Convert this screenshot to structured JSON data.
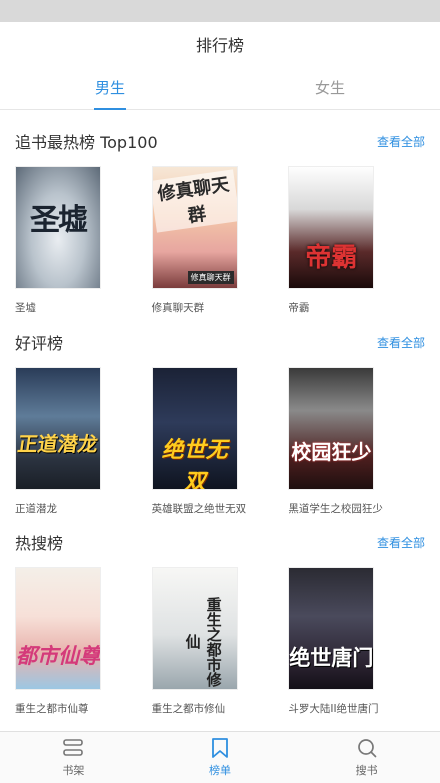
{
  "header": {
    "title": "排行榜"
  },
  "tabs": [
    {
      "label": "男生",
      "active": true
    },
    {
      "label": "女生",
      "active": false
    }
  ],
  "sections": [
    {
      "title": "追书最热榜 Top100",
      "see_all": "查看全部",
      "books": [
        {
          "name": "圣墟",
          "cover_text": "圣墟"
        },
        {
          "name": "修真聊天群",
          "cover_text": "修真聊天群",
          "cover_sub": "修真聊天群"
        },
        {
          "name": "帝霸",
          "cover_text": "帝霸"
        }
      ]
    },
    {
      "title": "好评榜",
      "see_all": "查看全部",
      "books": [
        {
          "name": "正道潜龙",
          "cover_text": "正道潜龙"
        },
        {
          "name": "英雄联盟之绝世无双",
          "cover_text": "绝世无双"
        },
        {
          "name": "黑道学生之校园狂少",
          "cover_text": "校园狂少"
        }
      ]
    },
    {
      "title": "热搜榜",
      "see_all": "查看全部",
      "books": [
        {
          "name": "重生之都市仙尊",
          "cover_text": "都市仙尊"
        },
        {
          "name": "重生之都市修仙",
          "cover_text": "重生之都市修仙"
        },
        {
          "name": "斗罗大陆II绝世唐门",
          "cover_text": "绝世唐门"
        }
      ]
    }
  ],
  "bottom_nav": [
    {
      "label": "书架",
      "icon": "bookshelf-icon",
      "active": false
    },
    {
      "label": "榜单",
      "icon": "bookmark-icon",
      "active": true
    },
    {
      "label": "搜书",
      "icon": "search-icon",
      "active": false
    }
  ],
  "colors": {
    "accent": "#2f8fe0",
    "status_bar": "#d9d9d9"
  }
}
